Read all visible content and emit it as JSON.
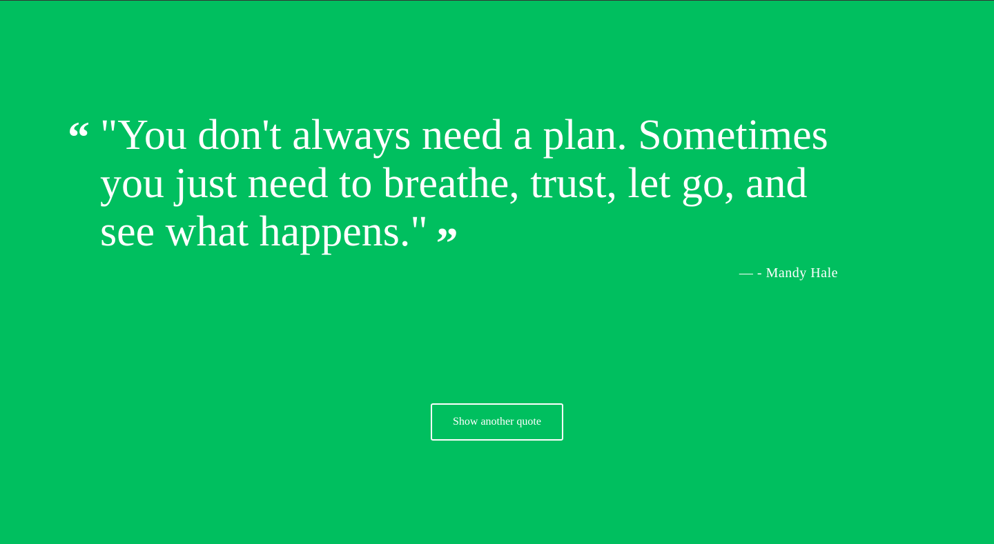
{
  "quote": {
    "open_icon": "left-double-quote-icon",
    "open_glyph": "“",
    "text": "\"You don't always need a plan. Sometimes you just need to breathe, trust, let go, and see what happens.\"",
    "close_icon": "right-double-quote-icon",
    "close_glyph": "”",
    "author": "— - Mandy Hale"
  },
  "button": {
    "label": "Show another quote"
  },
  "colors": {
    "background": "#00bf5f",
    "text": "#ffffff"
  }
}
